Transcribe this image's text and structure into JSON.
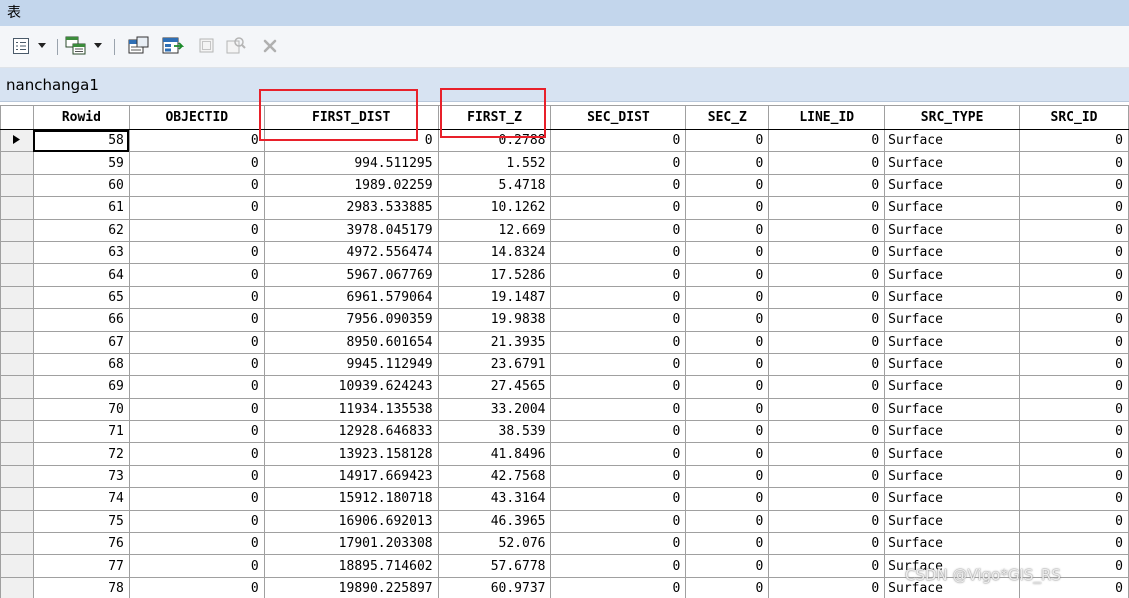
{
  "window": {
    "title": "表"
  },
  "toolbar": {
    "icons": [
      "table-options-icon",
      "dropdown-arrow-icon",
      "related-tables-icon",
      "dropdown-arrow-icon",
      "select-by-attributes-icon",
      "switch-selection-icon",
      "clear-selection-icon",
      "zoom-to-selected-icon",
      "delete-selected-icon"
    ]
  },
  "tab": {
    "label": "nanchanga1"
  },
  "table": {
    "columns": [
      "Rowid",
      "OBJECTID",
      "FIRST_DIST",
      "FIRST_Z",
      "SEC_DIST",
      "SEC_Z",
      "LINE_ID",
      "SRC_TYPE",
      "SRC_ID"
    ],
    "rows": [
      [
        "58",
        "0",
        "0",
        "0.2788",
        "0",
        "0",
        "0",
        "Surface",
        "0"
      ],
      [
        "59",
        "0",
        "994.511295",
        "1.552",
        "0",
        "0",
        "0",
        "Surface",
        "0"
      ],
      [
        "60",
        "0",
        "1989.02259",
        "5.4718",
        "0",
        "0",
        "0",
        "Surface",
        "0"
      ],
      [
        "61",
        "0",
        "2983.533885",
        "10.1262",
        "0",
        "0",
        "0",
        "Surface",
        "0"
      ],
      [
        "62",
        "0",
        "3978.045179",
        "12.669",
        "0",
        "0",
        "0",
        "Surface",
        "0"
      ],
      [
        "63",
        "0",
        "4972.556474",
        "14.8324",
        "0",
        "0",
        "0",
        "Surface",
        "0"
      ],
      [
        "64",
        "0",
        "5967.067769",
        "17.5286",
        "0",
        "0",
        "0",
        "Surface",
        "0"
      ],
      [
        "65",
        "0",
        "6961.579064",
        "19.1487",
        "0",
        "0",
        "0",
        "Surface",
        "0"
      ],
      [
        "66",
        "0",
        "7956.090359",
        "19.9838",
        "0",
        "0",
        "0",
        "Surface",
        "0"
      ],
      [
        "67",
        "0",
        "8950.601654",
        "21.3935",
        "0",
        "0",
        "0",
        "Surface",
        "0"
      ],
      [
        "68",
        "0",
        "9945.112949",
        "23.6791",
        "0",
        "0",
        "0",
        "Surface",
        "0"
      ],
      [
        "69",
        "0",
        "10939.624243",
        "27.4565",
        "0",
        "0",
        "0",
        "Surface",
        "0"
      ],
      [
        "70",
        "0",
        "11934.135538",
        "33.2004",
        "0",
        "0",
        "0",
        "Surface",
        "0"
      ],
      [
        "71",
        "0",
        "12928.646833",
        "38.539",
        "0",
        "0",
        "0",
        "Surface",
        "0"
      ],
      [
        "72",
        "0",
        "13923.158128",
        "41.8496",
        "0",
        "0",
        "0",
        "Surface",
        "0"
      ],
      [
        "73",
        "0",
        "14917.669423",
        "42.7568",
        "0",
        "0",
        "0",
        "Surface",
        "0"
      ],
      [
        "74",
        "0",
        "15912.180718",
        "43.3164",
        "0",
        "0",
        "0",
        "Surface",
        "0"
      ],
      [
        "75",
        "0",
        "16906.692013",
        "46.3965",
        "0",
        "0",
        "0",
        "Surface",
        "0"
      ],
      [
        "76",
        "0",
        "17901.203308",
        "52.076",
        "0",
        "0",
        "0",
        "Surface",
        "0"
      ],
      [
        "77",
        "0",
        "18895.714602",
        "57.6778",
        "0",
        "0",
        "0",
        "Surface",
        "0"
      ],
      [
        "78",
        "0",
        "19890.225897",
        "60.9737",
        "0",
        "0",
        "0",
        "Surface",
        "0"
      ]
    ]
  },
  "highlight": {
    "color": "#e8202a",
    "columns": [
      "FIRST_DIST",
      "FIRST_Z"
    ]
  },
  "watermark": {
    "text": "CSDN @Vigo*GIS_RS"
  }
}
